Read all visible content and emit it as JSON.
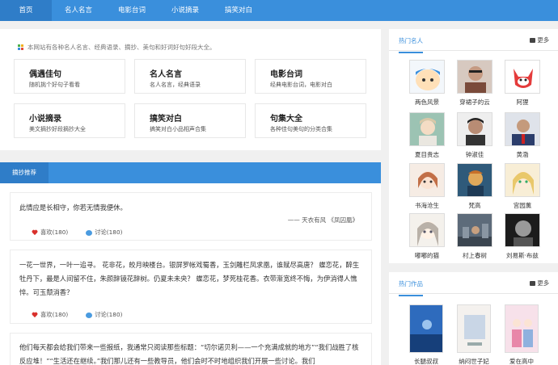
{
  "nav": [
    "首页",
    "名人名言",
    "电影台词",
    "小说摘录",
    "搞笑对白"
  ],
  "notice": "本网站有各种名人名言、经典语录、摘抄、美句和好词好句好段大全。",
  "categories": [
    {
      "title": "偶遇佳句",
      "desc": "随机挑个好句子看看"
    },
    {
      "title": "名人名言",
      "desc": "名人名言，经典语录"
    },
    {
      "title": "电影台词",
      "desc": "经典电影台词，电影对白"
    },
    {
      "title": "小说摘录",
      "desc": "美文摘抄好段摘抄大全"
    },
    {
      "title": "搞笑对白",
      "desc": "搞笑对白小品相声合集"
    },
    {
      "title": "句集大全",
      "desc": "各种佳句美句的分类合集"
    }
  ],
  "section_tab": "摘抄推荐",
  "posts": [
    {
      "text": "此情应是长相守，你若无情我便休。",
      "source": "—— 天衣有风 《凤囚凰》",
      "likes": "喜欢(180)",
      "comments": "讨论(180)"
    },
    {
      "text": "一花一世界，一叶一追寻。 花非花，皎月映楼台。银屏罗帐戏蜀香，玉剑雕栏凤求凰，谁赋尽高唐？ 蝶恋花，醉生牡丹下，最是人间留不住，朱颜辞镜花辞树。仍夏未未央？ 蝶恋花，梦死桂花香。衣带渐宽终不悔，为伊消得人憔悴。可玉颓消香？",
      "source": "",
      "likes": "喜欢(180)",
      "comments": "讨论(180)"
    },
    {
      "text": "他们每天都会给我们带来一些报纸，我通常只阅读那些标题：“切尔诺贝利——一个充满成就的地方”“我们战胜了核反应堆！”“生活还在继续。”我们那儿还有一些教导员，他们会时不时地组织我们开展一些讨论。我们",
      "source": "",
      "likes": "",
      "comments": ""
    }
  ],
  "hot_people": {
    "title": "热门名人",
    "more": "更多",
    "items": [
      "两色风景",
      "穿裙子的云",
      "阿狸",
      "夏目贵志",
      "钟淑佳",
      "黄渤",
      "书海沧生",
      "梵高",
      "宫园薰",
      "嘟嘟的猫",
      "村上春树",
      "刘易斯·布兹"
    ]
  },
  "hot_works": {
    "title": "热门作品",
    "more": "更多",
    "items": [
      "长腿叔叔",
      "纳闷世子妃",
      "爱在高中"
    ]
  },
  "colors": {
    "accent": "#3a8fdc",
    "accent_dark": "#2f7dc8",
    "like": "#d9302c"
  }
}
